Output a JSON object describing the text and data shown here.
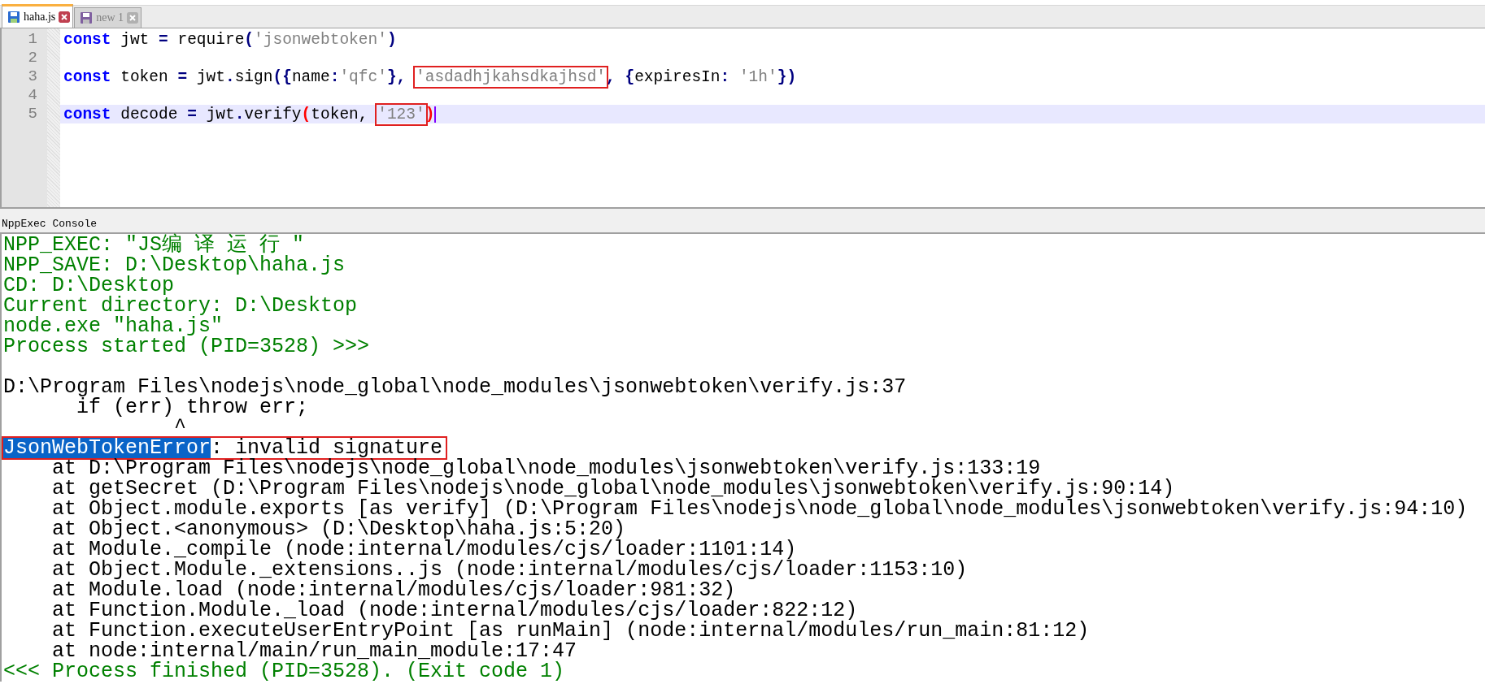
{
  "tabs": [
    {
      "label": "haha.js",
      "selected": true
    },
    {
      "label": "new 1",
      "selected": false
    }
  ],
  "editor": {
    "lines": [
      {
        "number": "1",
        "current": false,
        "tokens": [
          {
            "kind": "keyword",
            "text": "const"
          },
          {
            "kind": "plain",
            "text": " jwt "
          },
          {
            "kind": "operator",
            "text": "="
          },
          {
            "kind": "plain",
            "text": " require"
          },
          {
            "kind": "operator",
            "text": "("
          },
          {
            "kind": "string",
            "text": "'jsonwebtoken'"
          },
          {
            "kind": "operator",
            "text": ")"
          }
        ]
      },
      {
        "number": "2",
        "current": false
      },
      {
        "number": "3",
        "current": false,
        "tokens": [
          {
            "kind": "keyword",
            "text": "const"
          },
          {
            "kind": "plain",
            "text": " token "
          },
          {
            "kind": "operator",
            "text": "="
          },
          {
            "kind": "plain",
            "text": " jwt"
          },
          {
            "kind": "operator",
            "text": "."
          },
          {
            "kind": "plain",
            "text": "sign"
          },
          {
            "kind": "operator",
            "text": "({"
          },
          {
            "kind": "plain",
            "text": "name"
          },
          {
            "kind": "operator",
            "text": ":"
          },
          {
            "kind": "string",
            "text": "'qfc'"
          },
          {
            "kind": "operator",
            "text": "}, "
          },
          {
            "kind": "string",
            "text": "'asdadhjkahsdkajhsd'",
            "boxed": true
          },
          {
            "kind": "operator",
            "text": ", {"
          },
          {
            "kind": "plain",
            "text": "expiresIn"
          },
          {
            "kind": "operator",
            "text": ": "
          },
          {
            "kind": "string",
            "text": "'1h'"
          },
          {
            "kind": "operator",
            "text": "})"
          }
        ]
      },
      {
        "number": "4",
        "current": false
      },
      {
        "number": "5",
        "current": true,
        "tokens": [
          {
            "kind": "keyword",
            "text": "const"
          },
          {
            "kind": "plain",
            "text": " decode "
          },
          {
            "kind": "operator",
            "text": "="
          },
          {
            "kind": "plain",
            "text": " jwt"
          },
          {
            "kind": "operator",
            "text": "."
          },
          {
            "kind": "plain",
            "text": "verify"
          },
          {
            "kind": "match",
            "text": "("
          },
          {
            "kind": "plain",
            "text": "token, "
          },
          {
            "kind": "string",
            "text": "'123'",
            "boxed": true
          },
          {
            "kind": "match",
            "text": ")"
          }
        ]
      }
    ]
  },
  "console": {
    "title": "NppExec Console",
    "lines": [
      {
        "kind": "info",
        "text": "NPP_EXEC: \"JS编 译 运 行 \""
      },
      {
        "kind": "info",
        "text": "NPP_SAVE: D:\\Desktop\\haha.js"
      },
      {
        "kind": "info",
        "text": "CD: D:\\Desktop"
      },
      {
        "kind": "info",
        "text": "Current directory: D:\\Desktop"
      },
      {
        "kind": "info",
        "text": "node.exe \"haha.js\""
      },
      {
        "kind": "info",
        "text": "Process started (PID=3528) >>>"
      },
      {
        "kind": "blank"
      },
      {
        "kind": "output",
        "text": "D:\\Program Files\\nodejs\\node_global\\node_modules\\jsonwebtoken\\verify.js:37"
      },
      {
        "kind": "output",
        "text": "      if (err) throw err;"
      },
      {
        "kind": "output",
        "text": "              ^"
      },
      {
        "kind": "error",
        "boxed": true,
        "parts": [
          {
            "text": "JsonWebTokenError",
            "selected": true
          },
          {
            "text": ": invalid signature",
            "selected": false
          }
        ]
      },
      {
        "kind": "output",
        "text": "    at D:\\Program Files\\nodejs\\node_global\\node_modules\\jsonwebtoken\\verify.js:133:19"
      },
      {
        "kind": "output",
        "text": "    at getSecret (D:\\Program Files\\nodejs\\node_global\\node_modules\\jsonwebtoken\\verify.js:90:14)"
      },
      {
        "kind": "output",
        "text": "    at Object.module.exports [as verify] (D:\\Program Files\\nodejs\\node_global\\node_modules\\jsonwebtoken\\verify.js:94:10)"
      },
      {
        "kind": "output",
        "text": "    at Object.<anonymous> (D:\\Desktop\\haha.js:5:20)"
      },
      {
        "kind": "output",
        "text": "    at Module._compile (node:internal/modules/cjs/loader:1101:14)"
      },
      {
        "kind": "output",
        "text": "    at Object.Module._extensions..js (node:internal/modules/cjs/loader:1153:10)"
      },
      {
        "kind": "output",
        "text": "    at Module.load (node:internal/modules/cjs/loader:981:32)"
      },
      {
        "kind": "output",
        "text": "    at Function.Module._load (node:internal/modules/cjs/loader:822:12)"
      },
      {
        "kind": "output",
        "text": "    at Function.executeUserEntryPoint [as runMain] (node:internal/modules/run_main:81:12)"
      },
      {
        "kind": "output",
        "text": "    at node:internal/main/run_main_module:17:47"
      },
      {
        "kind": "info",
        "text": "<<< Process finished (PID=3528). (Exit code 1)"
      }
    ]
  }
}
